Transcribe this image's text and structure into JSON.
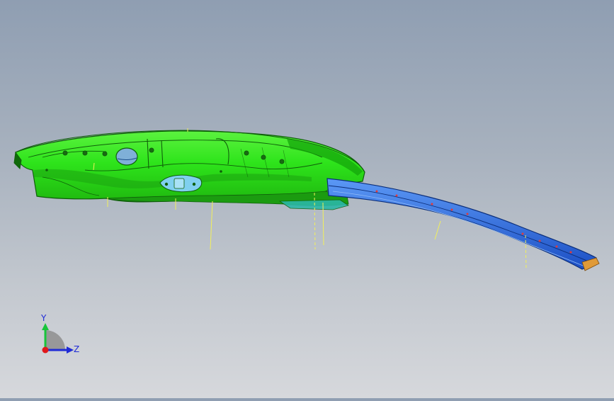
{
  "viewport": {
    "part_body_color": "#2fe01a",
    "part_edge_color": "#0f5f0a",
    "rail_color": "#2b6fe6",
    "rail_edge_color": "#0b2e7a",
    "callout_line_color": "#f2f05a",
    "background_top": "#8f9eb2",
    "background_bottom": "#d6d8dc"
  },
  "triad": {
    "x_axis": "",
    "y_axis": "Y",
    "z_axis": "Z",
    "y_color": "#17c43a",
    "z_color": "#1f2bd6",
    "origin_color": "#e0181c",
    "icons": [
      "axis-triad-icon"
    ]
  }
}
